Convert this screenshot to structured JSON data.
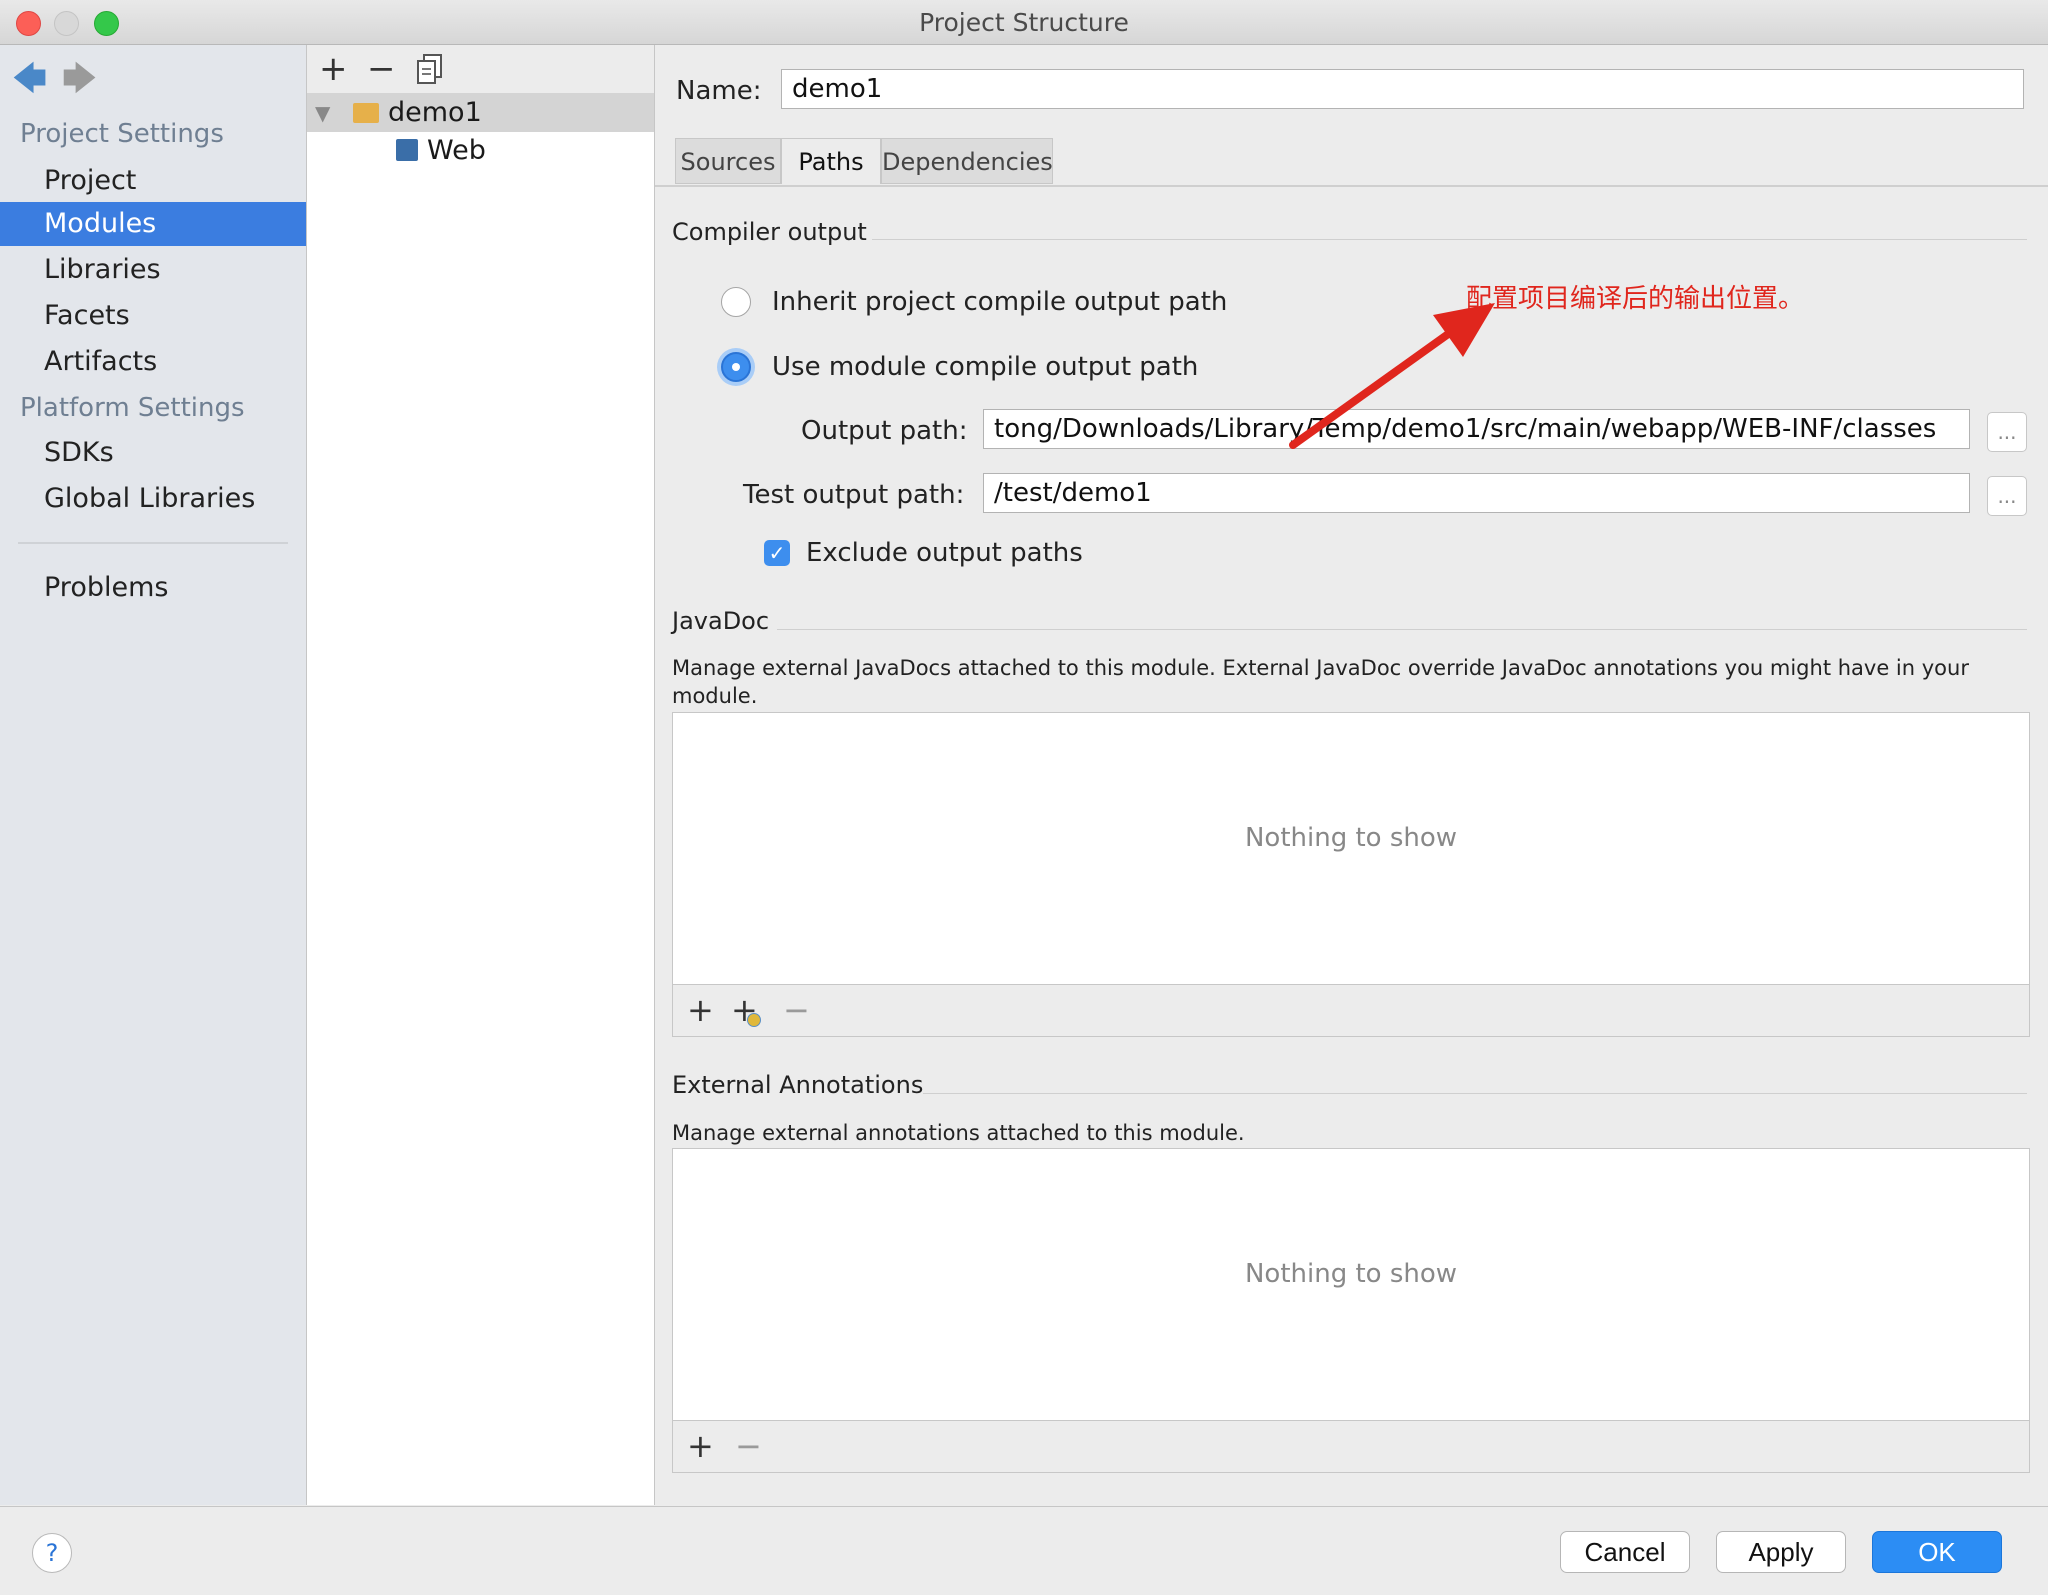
{
  "window": {
    "title": "Project Structure"
  },
  "sidebar": {
    "project_settings_heading": "Project Settings",
    "platform_settings_heading": "Platform Settings",
    "items": [
      {
        "label": "Project"
      },
      {
        "label": "Modules",
        "selected": true
      },
      {
        "label": "Libraries"
      },
      {
        "label": "Facets"
      },
      {
        "label": "Artifacts"
      },
      {
        "label": "SDKs"
      },
      {
        "label": "Global Libraries"
      },
      {
        "label": "Problems"
      }
    ]
  },
  "tree": {
    "toolbar": {
      "add": "+",
      "remove": "−"
    },
    "nodes": [
      {
        "label": "demo1",
        "expanded": true,
        "selected": true
      },
      {
        "label": "Web"
      }
    ]
  },
  "module": {
    "name_label": "Name:",
    "name_value": "demo1",
    "tabs": [
      {
        "label": "Sources"
      },
      {
        "label": "Paths",
        "active": true
      },
      {
        "label": "Dependencies"
      }
    ]
  },
  "compiler_output": {
    "heading": "Compiler output",
    "inherit_label": "Inherit project compile output path",
    "use_module_label": "Use module compile output path",
    "selected_option": "use_module",
    "output_path_label": "Output path:",
    "output_path_value": "tong/Downloads/Library/Temp/demo1/src/main/webapp/WEB-INF/classes",
    "test_output_path_label": "Test output path:",
    "test_output_path_value": "/test/demo1",
    "browse_label": "...",
    "exclude_label": "Exclude output paths",
    "exclude_checked": true,
    "annotation_text": "配置项目编译后的输出位置。"
  },
  "javadoc": {
    "heading": "JavaDoc",
    "description": "Manage external JavaDocs attached to this module. External JavaDoc override JavaDoc annotations you might have in your module.",
    "empty_text": "Nothing to show",
    "add": "+",
    "add_web": "+",
    "remove": "−"
  },
  "external_annotations": {
    "heading": "External Annotations",
    "description": "Manage external annotations attached to this module.",
    "empty_text": "Nothing to show",
    "add": "+",
    "remove": "−"
  },
  "buttons": {
    "help": "?",
    "cancel": "Cancel",
    "apply": "Apply",
    "ok": "OK"
  },
  "colors": {
    "accent": "#3b7de0",
    "annotation": "#e0261d",
    "primary_button": "#2c8df4"
  }
}
